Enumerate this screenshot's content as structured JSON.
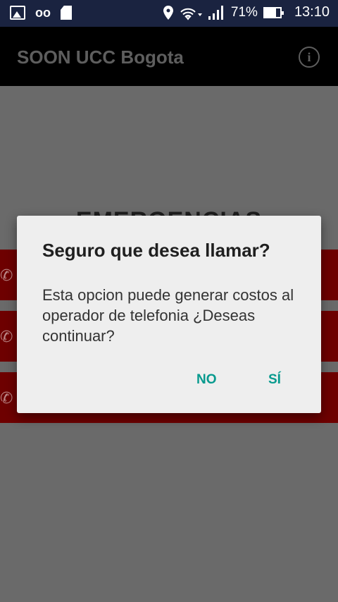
{
  "status_bar": {
    "battery_text": "71%",
    "battery_level": 0.71,
    "time": "13:10",
    "icons": [
      "image-icon",
      "voicemail-icon",
      "sd-card-icon",
      "location-icon",
      "wifi-icon",
      "signal-icon",
      "battery-icon"
    ]
  },
  "app_bar": {
    "title": "SOON UCC Bogota",
    "info_label": "i"
  },
  "background": {
    "section_title": "EMERGENCIAS",
    "rows": [
      {
        "label": ""
      },
      {
        "label": ""
      },
      {
        "label": ""
      }
    ]
  },
  "dialog": {
    "title": "Seguro que desea llamar?",
    "message": "Esta opcion puede generar costos al operador de telefonia ¿Deseas continuar?",
    "negative_button": "NO",
    "positive_button": "SÍ"
  },
  "colors": {
    "status_bar_bg": "#1a2340",
    "scrim": "#6a6a6a",
    "emergency_row": "#6e0000",
    "dialog_bg": "#eeeeee",
    "accent": "#079a8e"
  }
}
